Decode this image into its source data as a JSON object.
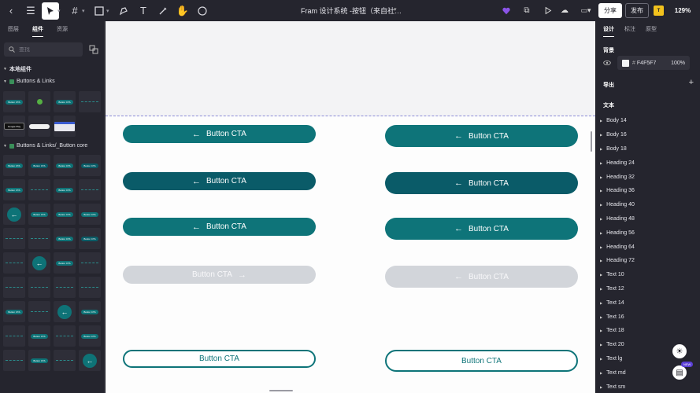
{
  "topbar": {
    "title": "Fram 设计系统 -按钮（来自社…",
    "share_label": "分享",
    "publish_label": "发布",
    "user_initial": "T",
    "zoom": "129%"
  },
  "left_panel": {
    "tabs": [
      "图层",
      "组件",
      "资源"
    ],
    "search_placeholder": "查找",
    "local_components_label": "本地组件",
    "section1_label": "Buttons & Links",
    "section2_label": "Buttons & Links/_Button core"
  },
  "thumb_text": "Button CTA",
  "store_badge_text": "Google Play",
  "canvas": {
    "button_label": "Button CTA",
    "colors": {
      "teal": "#0e7479",
      "dark_teal": "#0a5b68",
      "disabled": "#d2d5da",
      "frame_bg": "#fdfdfd"
    }
  },
  "right_panel": {
    "tabs": [
      "设计",
      "标注",
      "原型"
    ],
    "background_label": "背景",
    "bg_hex": "F4F5F7",
    "bg_opacity": "100%",
    "export_label": "导出",
    "text_label": "文本",
    "text_styles": [
      "Body 14",
      "Body 16",
      "Body 18",
      "Heading 24",
      "Heading 32",
      "Heading 36",
      "Heading 40",
      "Heading 48",
      "Heading 56",
      "Heading 64",
      "Heading 72",
      "Text 10",
      "Text 12",
      "Text 14",
      "Text 16",
      "Text 18",
      "Text 20",
      "Text lg",
      "Text md",
      "Text sm"
    ],
    "new_badge": "NEW"
  }
}
